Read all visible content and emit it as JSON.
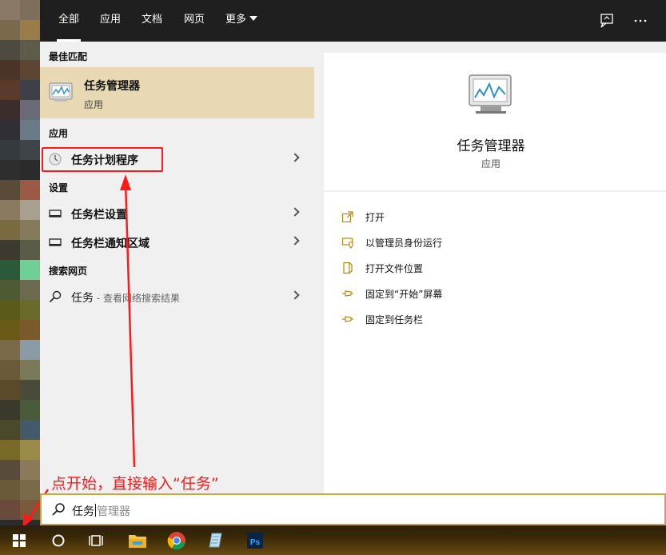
{
  "tabs": {
    "all": "全部",
    "apps": "应用",
    "docs": "文档",
    "web": "网页",
    "more": "更多"
  },
  "left": {
    "best_match_header": "最佳匹配",
    "best_match": {
      "title": "任务管理器",
      "subtitle": "应用"
    },
    "apps_header": "应用",
    "apps": [
      {
        "label": "任务计划程序"
      }
    ],
    "settings_header": "设置",
    "settings": [
      {
        "label": "任务栏设置"
      },
      {
        "label": "任务栏通知区域"
      }
    ],
    "web_header": "搜索网页",
    "web": {
      "query": "任务",
      "hint": " - 查看网络搜索结果"
    }
  },
  "right": {
    "app_name": "任务管理器",
    "app_type": "应用",
    "actions": [
      {
        "label": "打开",
        "icon": "open-icon"
      },
      {
        "label": "以管理员身份运行",
        "icon": "shield-icon"
      },
      {
        "label": "打开文件位置",
        "icon": "folder-location-icon"
      },
      {
        "label": "固定到“开始”屏幕",
        "icon": "pin-icon"
      },
      {
        "label": "固定到任务栏",
        "icon": "pin-icon"
      }
    ]
  },
  "annotation": "点开始，直接输入“任务”",
  "search": {
    "typed": "任务",
    "suggestion": "管理器"
  },
  "taskbar": [
    "windows-start",
    "cortana",
    "task-view",
    "file-explorer",
    "chrome",
    "app",
    "photoshop"
  ],
  "colors": {
    "accent": "#e8d8b3",
    "annotation": "#ff1a1a"
  }
}
